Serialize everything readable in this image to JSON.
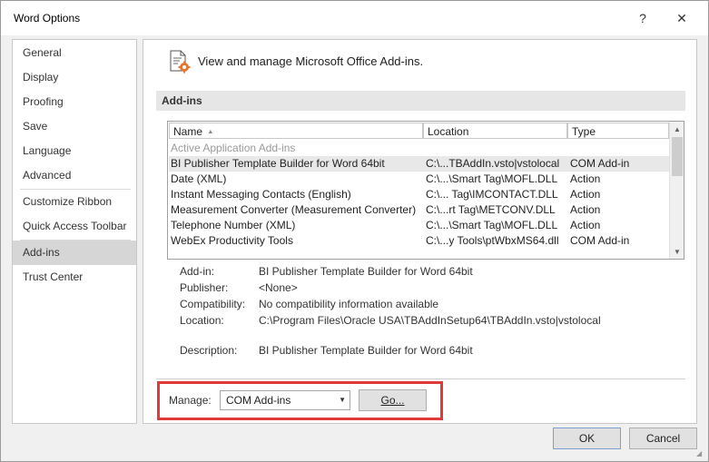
{
  "window": {
    "title": "Word Options",
    "help": "?",
    "close": "✕"
  },
  "nav": {
    "items": [
      {
        "label": "General"
      },
      {
        "label": "Display"
      },
      {
        "label": "Proofing"
      },
      {
        "label": "Save"
      },
      {
        "label": "Language"
      },
      {
        "label": "Advanced"
      },
      {
        "label": "Customize Ribbon"
      },
      {
        "label": "Quick Access Toolbar"
      },
      {
        "label": "Add-ins",
        "selected": true
      },
      {
        "label": "Trust Center"
      }
    ]
  },
  "content": {
    "heading": "View and manage Microsoft Office Add-ins.",
    "section": "Add-ins",
    "columns": {
      "name": "Name",
      "name_sort": "▲",
      "location": "Location",
      "type": "Type"
    },
    "group": "Active Application Add-ins",
    "rows": [
      {
        "name": "BI Publisher Template Builder for Word 64bit",
        "location": "C:\\...TBAddIn.vsto|vstolocal",
        "type": "COM Add-in",
        "selected": true
      },
      {
        "name": "Date (XML)",
        "location": "C:\\...\\Smart Tag\\MOFL.DLL",
        "type": "Action"
      },
      {
        "name": "Instant Messaging Contacts (English)",
        "location": "C:\\... Tag\\IMCONTACT.DLL",
        "type": "Action"
      },
      {
        "name": "Measurement Converter (Measurement Converter)",
        "location": "C:\\...rt Tag\\METCONV.DLL",
        "type": "Action"
      },
      {
        "name": "Telephone Number (XML)",
        "location": "C:\\...\\Smart Tag\\MOFL.DLL",
        "type": "Action"
      },
      {
        "name": "WebEx Productivity Tools",
        "location": "C:\\...y Tools\\ptWbxMS64.dll",
        "type": "COM Add-in"
      }
    ],
    "details": {
      "addin_label": "Add-in:",
      "addin_value": "BI Publisher Template Builder for Word 64bit",
      "publisher_label": "Publisher:",
      "publisher_value": "<None>",
      "compat_label": "Compatibility:",
      "compat_value": "No compatibility information available",
      "location_label": "Location:",
      "location_value": "C:\\Program Files\\Oracle USA\\TBAddInSetup64\\TBAddIn.vsto|vstolocal",
      "description_label": "Description:",
      "description_value": "BI Publisher Template Builder for Word 64bit"
    },
    "manage": {
      "label": "Manage:",
      "selected": "COM Add-ins",
      "go": "Go..."
    }
  },
  "footer": {
    "ok": "OK",
    "cancel": "Cancel"
  },
  "colors": {
    "highlight": "#e0393a",
    "selected_nav": "#d6d6d6",
    "accent": "#e8772e"
  }
}
